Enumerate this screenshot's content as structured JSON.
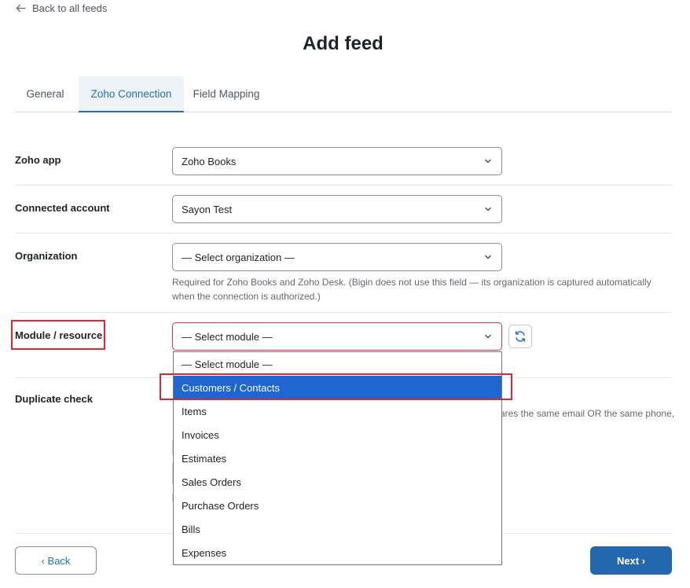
{
  "nav": {
    "back_to_feeds": "Back to all feeds"
  },
  "page": {
    "title": "Add feed"
  },
  "tabs": [
    {
      "label": "General"
    },
    {
      "label": "Zoho Connection",
      "active": true
    },
    {
      "label": "Field Mapping"
    }
  ],
  "form": {
    "zoho_app": {
      "label": "Zoho app",
      "value": "Zoho Books"
    },
    "connected_account": {
      "label": "Connected account",
      "value": "Sayon Test"
    },
    "organization": {
      "label": "Organization",
      "value": "— Select organization —",
      "help": "Required for Zoho Books and Zoho Desk. (Bigin does not use this field — its organization is captured automatically when the connection is authorized.)"
    },
    "module": {
      "label": "Module / resource",
      "value": "— Select module —"
    },
    "duplicate_check": {
      "label": "Duplicate check",
      "help_partial": "ares the same email OR the same phone,"
    }
  },
  "module_dropdown": {
    "options": [
      "— Select module —",
      "Customers / Contacts",
      "Items",
      "Invoices",
      "Estimates",
      "Sales Orders",
      "Purchase Orders",
      "Bills",
      "Expenses"
    ],
    "highlighted": "Customers / Contacts"
  },
  "footer": {
    "back_label": "‹ Back",
    "next_label": "Next ›"
  },
  "colors": {
    "accent": "#2271b1",
    "primary_button": "#2367ae",
    "selection": "#1f66d1",
    "annotation": "#e0262e"
  },
  "icons": {
    "back": "arrow-left-icon",
    "chevron": "chevron-down-icon",
    "refresh": "refresh-icon"
  }
}
